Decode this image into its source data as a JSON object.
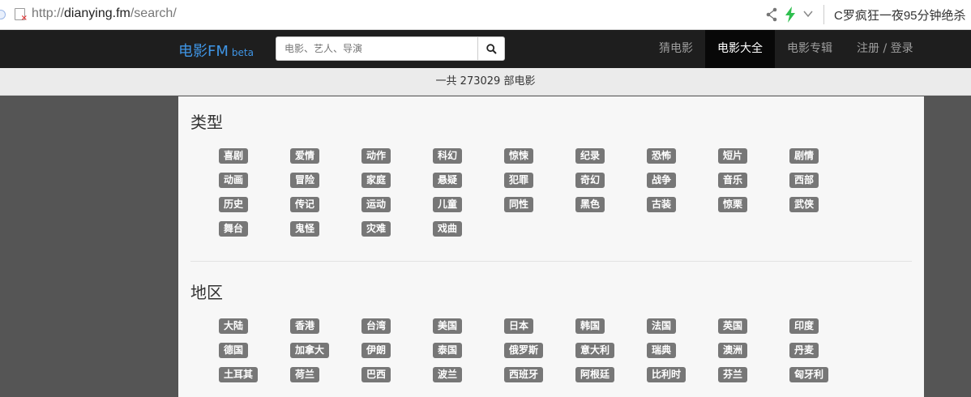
{
  "browser": {
    "url_scheme": "http://",
    "url_domain": "dianying.fm",
    "url_path": "/search/",
    "tab_title": "C罗疯狂一夜95分钟绝杀"
  },
  "nav": {
    "brand": "电影FM",
    "brand_beta": "beta",
    "search_placeholder": "电影、艺人、导演",
    "items": [
      {
        "label": "猜电影",
        "active": false
      },
      {
        "label": "电影大全",
        "active": true
      },
      {
        "label": "电影专辑",
        "active": false
      },
      {
        "label": "注册 / 登录",
        "active": false
      }
    ]
  },
  "count_text": "一共 273029 部电影",
  "sections": [
    {
      "title": "类型",
      "tags": [
        "喜剧",
        "爱情",
        "动作",
        "科幻",
        "惊悚",
        "纪录",
        "恐怖",
        "短片",
        "剧情",
        "动画",
        "冒险",
        "家庭",
        "悬疑",
        "犯罪",
        "奇幻",
        "战争",
        "音乐",
        "西部",
        "历史",
        "传记",
        "运动",
        "儿童",
        "同性",
        "黑色",
        "古装",
        "惊栗",
        "武侠",
        "舞台",
        "鬼怪",
        "灾难",
        "戏曲"
      ]
    },
    {
      "title": "地区",
      "tags": [
        "大陆",
        "香港",
        "台湾",
        "美国",
        "日本",
        "韩国",
        "法国",
        "英国",
        "印度",
        "德国",
        "加拿大",
        "伊朗",
        "泰国",
        "俄罗斯",
        "意大利",
        "瑞典",
        "澳洲",
        "丹麦",
        "土耳其",
        "荷兰",
        "巴西",
        "波兰",
        "西班牙",
        "阿根廷",
        "比利时",
        "芬兰",
        "匈牙利"
      ]
    }
  ],
  "colors": {
    "brand": "#3f95e5",
    "navbar_bg": "#1e1e1e",
    "tag_bg": "#777777"
  }
}
